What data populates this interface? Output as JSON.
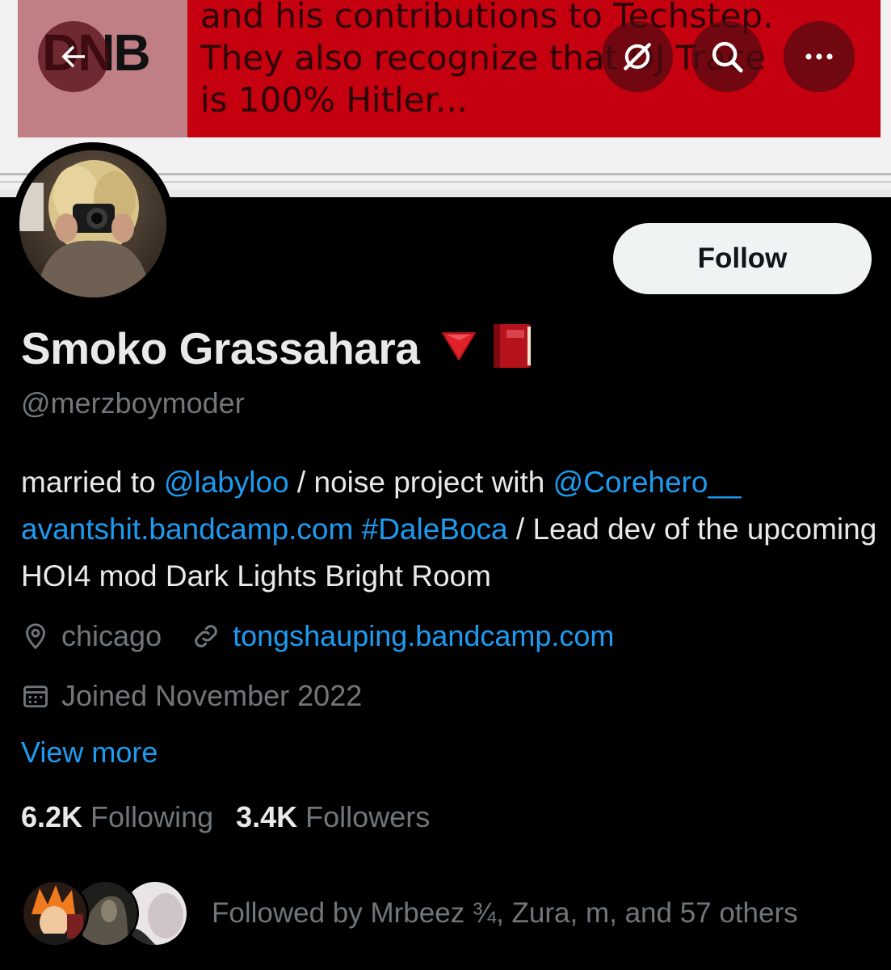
{
  "banner": {
    "logo_text": "DNB",
    "text": "and his contributions to Techstep.\nThey also recognize that DJ Trace\nis 100% Hitler..."
  },
  "top_bar": {
    "back_icon": "arrow-left-icon",
    "grok_icon": "slashed-circle-icon",
    "search_icon": "search-icon",
    "more_icon": "more-icon"
  },
  "profile": {
    "follow_label": "Follow",
    "display_name": "Smoko Grassahara",
    "name_emojis": [
      "🔻",
      "📕"
    ],
    "handle": "@merzboymoder",
    "bio": {
      "t1": "married to ",
      "l1": "@labyloo",
      "t2": " / noise project with ",
      "l2": "@Corehero__",
      "l3": "avantshit.bandcamp.com",
      "t3": " ",
      "l4": "#DaleBoca",
      "t4": " / Lead dev of the upcoming HOI4 mod Dark Lights Bright Room"
    },
    "location": "chicago",
    "website": "tongshauping.bandcamp.com",
    "joined": "Joined November 2022",
    "view_more": "View more",
    "following_count": "6.2K",
    "following_label": "Following",
    "followers_count": "3.4K",
    "followers_label": "Followers",
    "followed_by": "Followed by Mrbeez ¾, Zura, m, and 57 others"
  },
  "colors": {
    "background": "#000000",
    "text_primary": "#e7e9ea",
    "text_secondary": "#71767b",
    "link": "#1d9bf0",
    "banner_red": "#c5000f",
    "follow_bg": "#eff3f4"
  }
}
